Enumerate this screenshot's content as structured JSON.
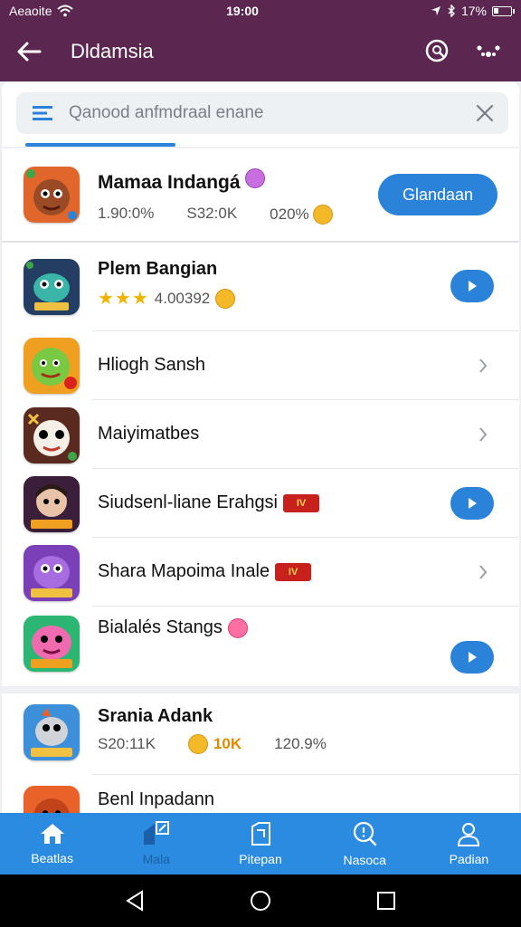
{
  "status_bar": {
    "carrier": "Aeaoite",
    "time": "19:00",
    "battery": "17%"
  },
  "app_bar": {
    "title": "Dldamsia"
  },
  "search": {
    "placeholder": "Qanood anfmdraal enane"
  },
  "featured": {
    "name": "Mamaa Indangá",
    "stat1": "1.90:0%",
    "stat2": "S32:0K",
    "stat3": "020%",
    "button": "Glandaan"
  },
  "list": [
    {
      "name": "Plem Bangian",
      "rating_text": "4.00392",
      "stars": 3,
      "action": "play"
    },
    {
      "name": "Hliogh Sansh",
      "action": "chevron"
    },
    {
      "name": "Maiyimatbes",
      "action": "chevron"
    },
    {
      "name": "Siudsenl-liane Erahgsi",
      "badge": "IV",
      "action": "play"
    },
    {
      "name": "Shara Mapoima Inale",
      "badge": "IV",
      "action": "chevron"
    },
    {
      "name": "Bialalés Stangs",
      "action": "play"
    },
    {
      "name": "Srania Adank",
      "stat1": "S20:11K",
      "stat2": "10K",
      "stat3": "120.9%",
      "action": "none"
    },
    {
      "name": "Benl Inpadann",
      "action": "none"
    }
  ],
  "bottom_nav": [
    {
      "label": "Beatlas",
      "icon": "home-icon"
    },
    {
      "label": "Mala",
      "icon": "store-icon"
    },
    {
      "label": "Pitepan",
      "icon": "document-icon"
    },
    {
      "label": "Nasoca",
      "icon": "search-icon"
    },
    {
      "label": "Padian",
      "icon": "profile-icon"
    }
  ],
  "colors": {
    "primary": "#5b2650",
    "accent": "#2a83d8",
    "nav": "#2a8be0"
  }
}
